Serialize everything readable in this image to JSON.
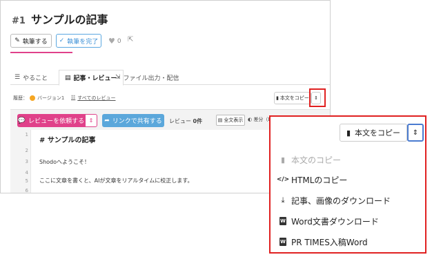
{
  "header": {
    "number": "#1",
    "title": "サンプルの記事"
  },
  "actions": {
    "write_label": "執筆する",
    "done_label": "執筆を完了",
    "like_count": "0"
  },
  "tabs": [
    {
      "label": "やること"
    },
    {
      "label": "記事・レビュー"
    },
    {
      "label": "ファイル出力・配信"
    }
  ],
  "history": {
    "label": "履歴：",
    "version": "バージョン1",
    "all_reviews": "すべてのレビュー"
  },
  "copy_select": {
    "label": "本文をコピー"
  },
  "toolbar": {
    "review_button": "レビューを依頼する",
    "link_button": "リンクで共有する",
    "review_label": "レビュー",
    "review_count": "0件",
    "fulltext_button": "全文表示",
    "diff_label": "差分（D）"
  },
  "editor": {
    "lines": [
      {
        "num": "1",
        "text": "# サンプルの記事"
      },
      {
        "num": "2",
        "text": ""
      },
      {
        "num": "3",
        "text": "Shodoへようこそ！"
      },
      {
        "num": "4",
        "text": ""
      },
      {
        "num": "5",
        "text": "ここに文章を書くと、AIが文章をリアルタイムに校正します。"
      },
      {
        "num": "6",
        "text": ""
      }
    ]
  },
  "dropdown": {
    "header_label": "本文をコピー",
    "items": [
      {
        "label": "本文のコピー",
        "icon": "clipboard-icon",
        "disabled": true
      },
      {
        "label": "HTMLのコピー",
        "icon": "code-icon",
        "disabled": false
      },
      {
        "label": "記事、画像のダウンロード",
        "icon": "download-icon",
        "disabled": false
      },
      {
        "label": "Word文書ダウンロード",
        "icon": "word-file-icon",
        "disabled": false
      },
      {
        "label": "PR TIMES入稿Word",
        "icon": "word-file-icon",
        "disabled": false
      }
    ]
  },
  "colors": {
    "accent_pink": "#e0418a",
    "accent_blue": "#5ba7db",
    "highlight_red": "#e02020"
  }
}
